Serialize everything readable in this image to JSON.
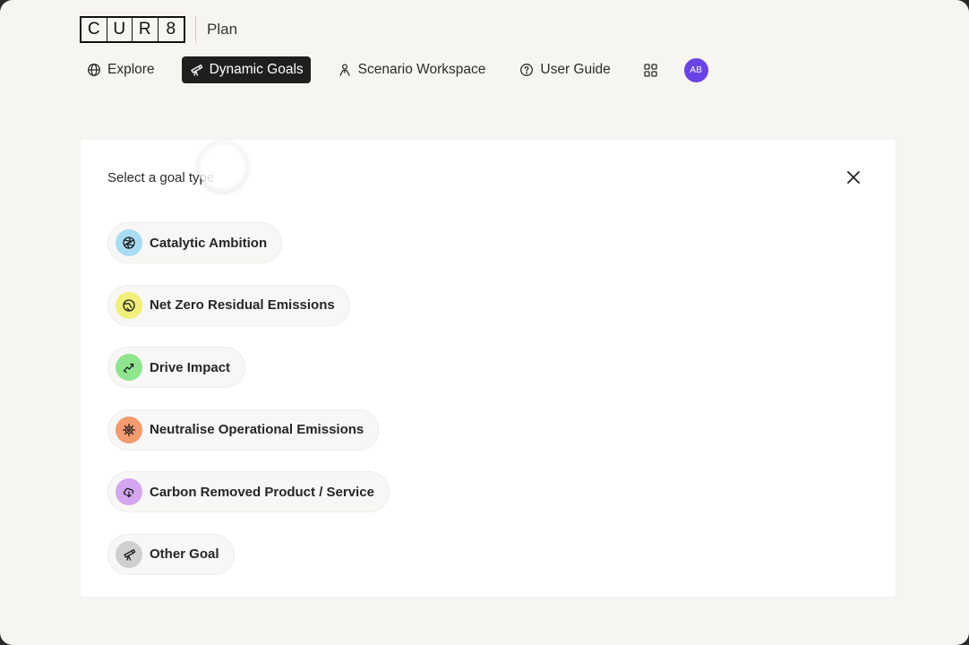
{
  "app": {
    "logo_letters": [
      "C",
      "U",
      "R",
      "8"
    ],
    "section": "Plan"
  },
  "nav": {
    "items": [
      {
        "label": "Explore",
        "icon": "globe-icon",
        "active": false
      },
      {
        "label": "Dynamic Goals",
        "icon": "telescope-icon",
        "active": true
      },
      {
        "label": "Scenario Workspace",
        "icon": "person-icon",
        "active": false
      },
      {
        "label": "User Guide",
        "icon": "help-circle-icon",
        "active": false
      }
    ],
    "apps_icon": "grid-icon",
    "avatar_initials": "AB",
    "avatar_color": "#6a43e8"
  },
  "panel": {
    "title": "Select a goal type",
    "close_icon": "close-icon",
    "goals": [
      {
        "label": "Catalytic Ambition",
        "icon": "aperture-icon",
        "color": "#a8dcf3"
      },
      {
        "label": "Net Zero Residual Emissions",
        "icon": "globe-check-icon",
        "color": "#f0f07a"
      },
      {
        "label": "Drive Impact",
        "icon": "trend-icon",
        "color": "#8fe58d"
      },
      {
        "label": "Neutralise Operational Emissions",
        "icon": "gear-icon",
        "color": "#f39a6e"
      },
      {
        "label": "Carbon Removed Product / Service",
        "icon": "cloud-download-icon",
        "color": "#d3a6ef"
      },
      {
        "label": "Other Goal",
        "icon": "telescope-icon",
        "color": "#cfcfcf"
      }
    ]
  }
}
